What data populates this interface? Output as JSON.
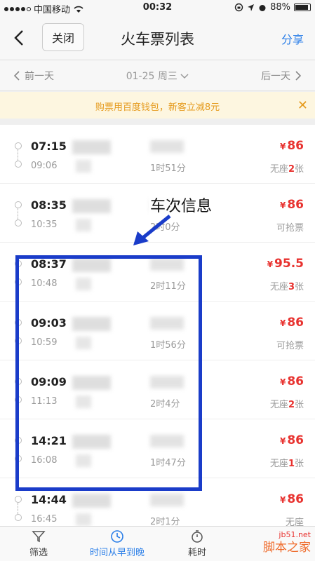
{
  "status_bar": {
    "carrier": "中国移动",
    "time": "00:32",
    "battery": "88%"
  },
  "nav": {
    "close_label": "关闭",
    "title": "火车票列表",
    "share_label": "分享"
  },
  "date_bar": {
    "prev_label": "前一天",
    "current_date": "01-25 周三",
    "next_label": "后一天"
  },
  "promo": {
    "text": "购票用百度钱包，新客立减8元"
  },
  "annotation": {
    "label": "车次信息"
  },
  "trains": [
    {
      "dep": "07:15",
      "arr": "09:06",
      "duration": "1时51分",
      "price": "86",
      "seat_prefix": "无座",
      "seat_count": "2",
      "seat_suffix": "张"
    },
    {
      "dep": "08:35",
      "arr": "10:35",
      "duration": "2时0分",
      "price": "86",
      "seat_prefix": "可抢票",
      "seat_count": "",
      "seat_suffix": ""
    },
    {
      "dep": "08:37",
      "arr": "10:48",
      "duration": "2时11分",
      "price": "95.5",
      "seat_prefix": "无座",
      "seat_count": "3",
      "seat_suffix": "张"
    },
    {
      "dep": "09:03",
      "arr": "10:59",
      "duration": "1时56分",
      "price": "86",
      "seat_prefix": "可抢票",
      "seat_count": "",
      "seat_suffix": ""
    },
    {
      "dep": "09:09",
      "arr": "11:13",
      "duration": "2时4分",
      "price": "86",
      "seat_prefix": "无座",
      "seat_count": "2",
      "seat_suffix": "张"
    },
    {
      "dep": "14:21",
      "arr": "16:08",
      "duration": "1时47分",
      "price": "86",
      "seat_prefix": "无座",
      "seat_count": "1",
      "seat_suffix": "张"
    },
    {
      "dep": "14:44",
      "arr": "16:45",
      "duration": "2时1分",
      "price": "86",
      "seat_prefix": "无座",
      "seat_count": "",
      "seat_suffix": ""
    }
  ],
  "currency_symbol": "¥",
  "bottom_tabs": {
    "filter_label": "筛选",
    "time_label": "时间从早到晚",
    "duration_label": "耗时"
  },
  "watermark": {
    "line1": "jb51.net",
    "line2": "脚本之家"
  },
  "colors": {
    "accent_blue": "#2a7ee8",
    "price_red": "#e8322f",
    "annotation_blue": "#1a3cc9",
    "promo_orange": "#e59a1c"
  }
}
